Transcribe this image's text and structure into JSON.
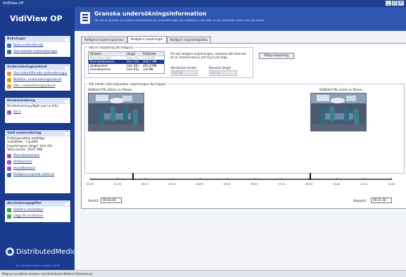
{
  "window": {
    "title": "VidiView OP",
    "controls": [
      "_",
      "□",
      "×"
    ]
  },
  "brand": {
    "name": "VidiView OP"
  },
  "header": {
    "title": "Granska undersökningsinformation",
    "description": "Här kan du granska och justera informationen om undersökningen och bestämma vilka delar av den inspelade videon som ska sparas."
  },
  "sidebar": {
    "bokningar": {
      "title": "Bokningar",
      "items": [
        "Boka undersökning",
        "Visa bokade undersökningar"
      ]
    },
    "undersokningsarkivet": {
      "title": "Undersökningsarkivet",
      "items": [
        "Visa oidentifierade undersökningar",
        "Bläddra i undersökningsarkivet",
        "Sök i undersökningsarkivet"
      ]
    },
    "direktsandning": {
      "title": "Direktsändning",
      "text": "Direktsändning pågår just nu från:",
      "items": [
        "Sal 3"
      ]
    },
    "vald": {
      "title": "Vald undersökning",
      "lines": [
        "Proteroperation ambläge",
        "3 bildfilder, 1 ljudfile",
        "Inspelningens längd: 14m 45s",
        "Total storlek: 2007,7MB"
      ],
      "items": [
        "Översiktskamera",
        "Ambkamera",
        "Huvudkamera",
        "Redigera inspelat material"
      ]
    },
    "anvandare": {
      "title": "Användaruppgifter",
      "items": [
        "Hantera användare",
        "Lägg till användare"
      ]
    },
    "logo": "DistributedMedical",
    "version": "Ver 2.8 beta   Build number: 2008"
  },
  "status": {
    "text": "Magnus Lundblad ansluten mot Distributed Medical Demoserver"
  },
  "tabs": [
    "Redigera inspelningsvision",
    "Redigera inspelningar",
    "Redigera inspelningsdata"
  ],
  "active_tab": 1,
  "recording": {
    "group_title": "Välj en inspelning att redigera",
    "columns": [
      "Filnamn",
      "Längd",
      "Filstorlek"
    ],
    "rows": [
      {
        "name": "Operationsljud",
        "length": "14m 45s",
        "size": "13,9 MB",
        "state": "dim"
      },
      {
        "name": "Översiktskamera",
        "length": "14m 45s",
        "size": "836,7 MB",
        "state": "selected"
      },
      {
        "name": "Ambkamera",
        "length": "14m 45s",
        "size": "491,8 MB",
        "state": "normal"
      },
      {
        "name": "Huvudkamera",
        "length": "14m 45s",
        "size": "3,8 MB",
        "state": "normal"
      }
    ],
    "info_text": "För att redigera inspelningen, markera det intervall du är intresserad av och tryck på klipp.",
    "button": "Klipp inspelning",
    "current_size_label": "Beräknad storlek:",
    "current_size": "0,0 kB",
    "new_length_label": "Resultat längd:",
    "new_length": "0m 0s"
  },
  "cut": {
    "group_title": "Välj mellan vilka tidpunkter inspelningen ska klippas",
    "start_title": "Ställbild från början av filmen:",
    "end_title": "Ställbild från slutet av filmen:",
    "ticks": [
      "00:00",
      "01:26",
      "02:01",
      "03:24",
      "04:05",
      "05:12",
      "06:23",
      "07:21",
      "08:23",
      "10:44",
      "12:11",
      "14:46"
    ],
    "start_label": "Startid:",
    "start_value": "00:03:06",
    "end_label": "Stopptid:",
    "end_value": "00:11:30",
    "start_marker": 0.14,
    "end_marker": 0.73
  }
}
